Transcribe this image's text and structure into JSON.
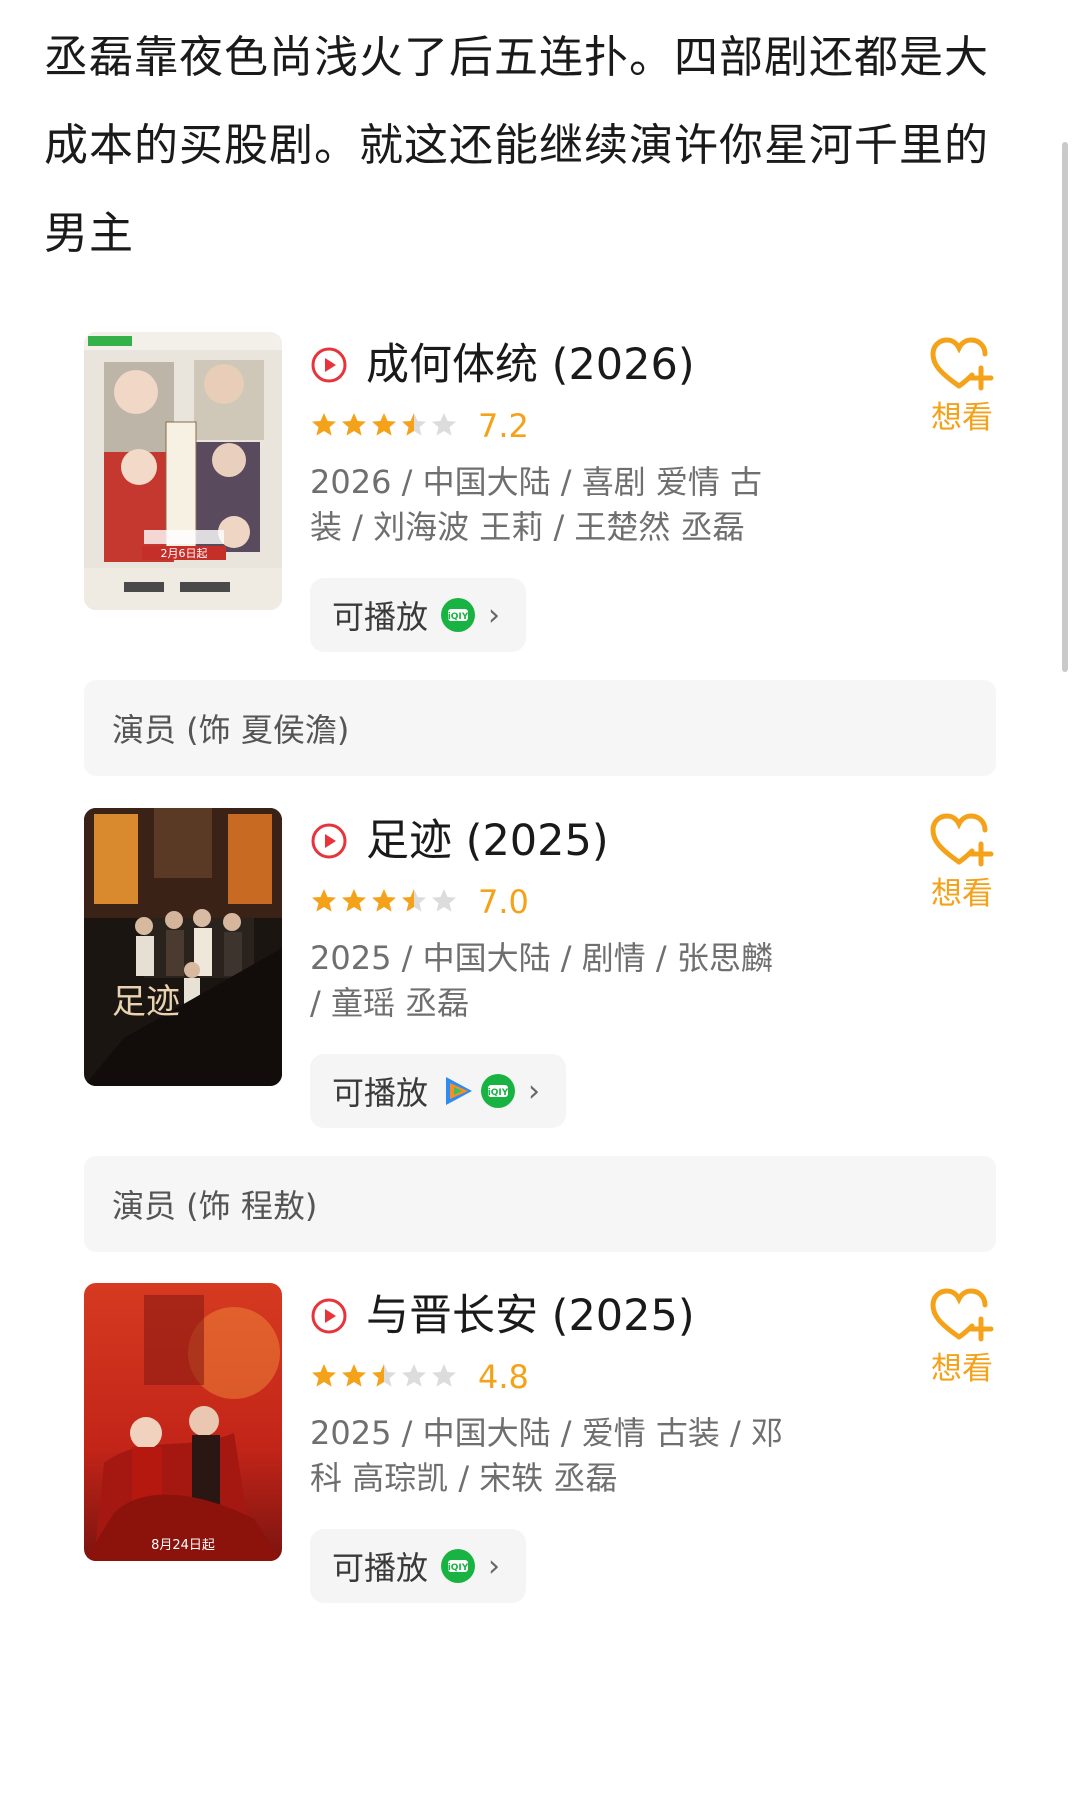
{
  "post": {
    "text": "丞磊靠夜色尚浅火了后五连扑。四部剧还都是大成本的买股剧。就这还能继续演许你星河千里的男主"
  },
  "accent_color": "#f4a21a",
  "cards": [
    {
      "title": "成何体统 (2026)",
      "rating_stars": 3.5,
      "score": "7.2",
      "meta": "2026 / 中国大陆 / 喜剧 爱情 古装 / 刘海波 王莉 / 王楚然 丞磊",
      "play_label": "可播放",
      "platforms": [
        "iqiyi-icon"
      ],
      "want_label": "想看",
      "role": "演员 (饰 夏侯澹)",
      "poster_text": "2月6日起"
    },
    {
      "title": "足迹 (2025)",
      "rating_stars": 3.5,
      "score": "7.0",
      "meta": "2025 / 中国大陆 / 剧情 / 张思麟 / 童瑶 丞磊",
      "play_label": "可播放",
      "platforms": [
        "tencent-video-icon",
        "iqiyi-icon"
      ],
      "want_label": "想看",
      "role": "演员 (饰 程敖)",
      "poster_text": "足迹"
    },
    {
      "title": "与晋长安 (2025)",
      "rating_stars": 2.5,
      "score": "4.8",
      "meta": "2025 / 中国大陆 / 爱情 古装 / 邓科 高琮凯 / 宋轶 丞磊",
      "play_label": "可播放",
      "platforms": [
        "iqiyi-icon"
      ],
      "want_label": "想看",
      "role": "",
      "poster_text": "8月24日起"
    }
  ]
}
